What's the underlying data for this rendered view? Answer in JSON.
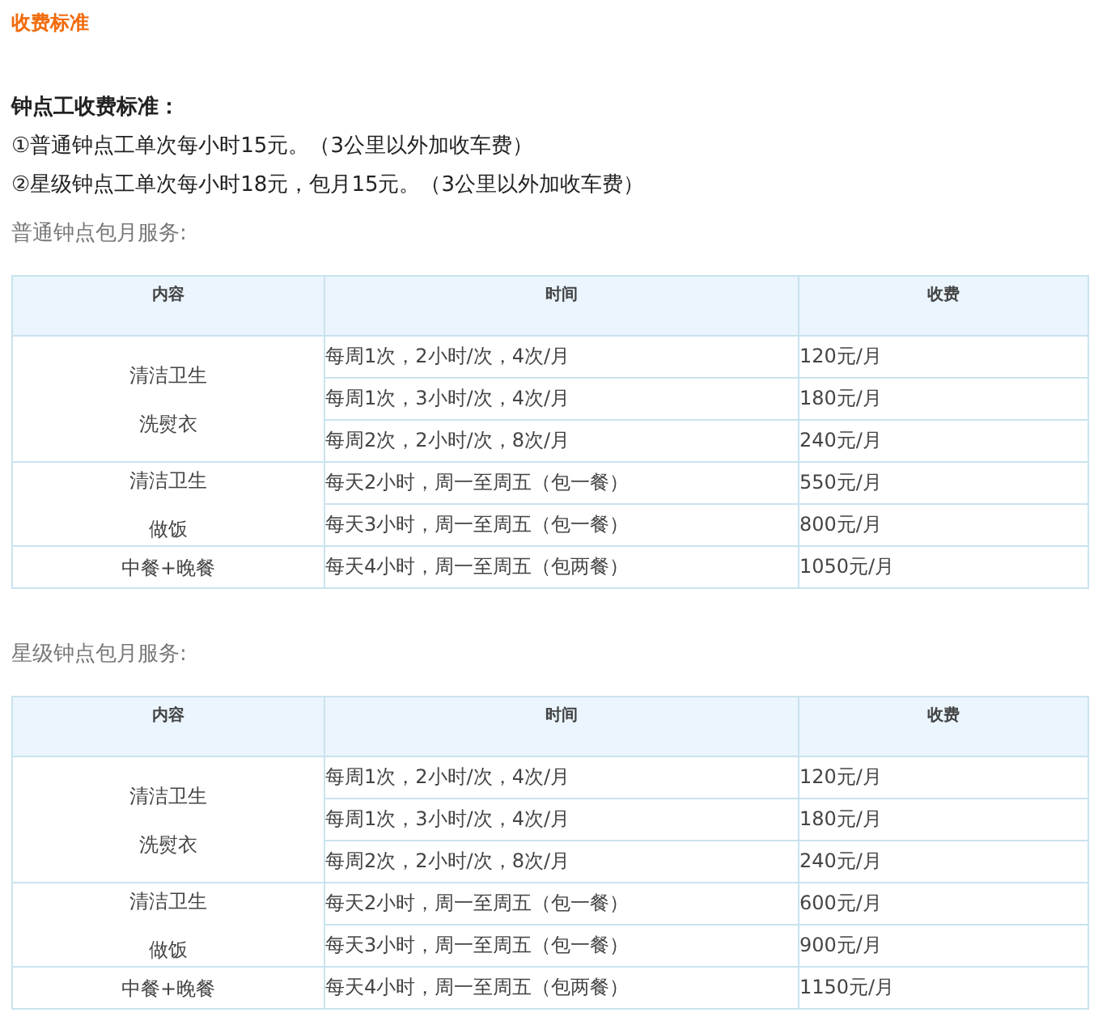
{
  "heading": "收费标准",
  "intro": {
    "title": "钟点工收费标准：",
    "lines": [
      "①普通钟点工单次每小时15元。（3公里以外加收车费）",
      "②星级钟点工单次每小时18元，包月15元。（3公里以外加收车费）"
    ]
  },
  "sections": [
    {
      "title": "普通钟点包月服务:",
      "columns": [
        "内容",
        "时间",
        "收费"
      ],
      "groups": [
        {
          "content": [
            "清洁卫生",
            "洗熨衣"
          ],
          "rows": [
            {
              "time": "每周1次，2小时/次，4次/月",
              "fee": "120元/月"
            },
            {
              "time": "每周1次，3小时/次，4次/月",
              "fee": "180元/月"
            },
            {
              "time": "每周2次，2小时/次，8次/月",
              "fee": "240元/月"
            }
          ]
        },
        {
          "content": [
            "清洁卫生",
            "做饭"
          ],
          "rows": [
            {
              "time": "每天2小时，周一至周五（包一餐）",
              "fee": "550元/月"
            },
            {
              "time": "每天3小时，周一至周五（包一餐）",
              "fee": "800元/月"
            }
          ]
        },
        {
          "content": [
            "中餐+晚餐"
          ],
          "rows": [
            {
              "time": "每天4小时，周一至周五（包两餐）",
              "fee": "1050元/月"
            }
          ]
        }
      ]
    },
    {
      "title": "星级钟点包月服务:",
      "columns": [
        "内容",
        "时间",
        "收费"
      ],
      "groups": [
        {
          "content": [
            "清洁卫生",
            "洗熨衣"
          ],
          "rows": [
            {
              "time": "每周1次，2小时/次，4次/月",
              "fee": "120元/月"
            },
            {
              "time": "每周1次，3小时/次，4次/月",
              "fee": "180元/月"
            },
            {
              "time": "每周2次，2小时/次，8次/月",
              "fee": "240元/月"
            }
          ]
        },
        {
          "content": [
            "清洁卫生",
            "做饭"
          ],
          "rows": [
            {
              "time": "每天2小时，周一至周五（包一餐）",
              "fee": "600元/月"
            },
            {
              "time": "每天3小时，周一至周五（包一餐）",
              "fee": "900元/月"
            }
          ]
        },
        {
          "content": [
            "中餐+晚餐"
          ],
          "rows": [
            {
              "time": "每天4小时，周一至周五（包两餐）",
              "fee": "1150元/月"
            }
          ]
        }
      ]
    }
  ]
}
